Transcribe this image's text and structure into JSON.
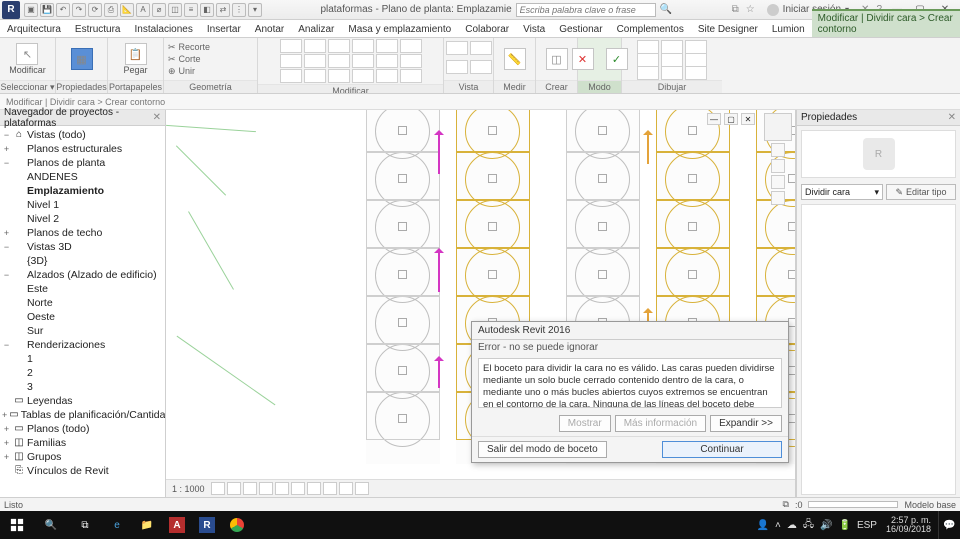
{
  "titlebar": {
    "doc_title": "plataformas - Plano de planta: Emplazamie",
    "search_placeholder": "Escriba palabra clave o frase",
    "login_label": "Iniciar sesión"
  },
  "tabs": {
    "items": [
      "Arquitectura",
      "Estructura",
      "Instalaciones",
      "Insertar",
      "Anotar",
      "Analizar",
      "Masa y emplazamiento",
      "Colaborar",
      "Vista",
      "Gestionar",
      "Complementos",
      "Site Designer",
      "Lumion"
    ],
    "context_label": "Modificar | Dividir cara > Crear contorno"
  },
  "ribbon": {
    "panels": {
      "seleccionar": "Seleccionar ▾",
      "modificar_btn": "Modificar",
      "propiedades": "Propiedades",
      "portapapeles": "Portapapeles",
      "pegar": "Pegar",
      "recorte": "Recorte",
      "corte": "Corte",
      "unir": "Unir",
      "geometria": "Geometría",
      "modificar": "Modificar",
      "vista": "Vista",
      "medir": "Medir",
      "crear": "Crear",
      "modo": "Modo",
      "dibujar": "Dibujar"
    }
  },
  "optbar": {
    "text": "Modificar | Dividir cara > Crear contorno"
  },
  "pb": {
    "title": "Navegador de proyectos - plataformas",
    "tree": [
      {
        "ind": 0,
        "tw": "−",
        "ic": "⌂",
        "label": "Vistas (todo)"
      },
      {
        "ind": 1,
        "tw": "+",
        "ic": "",
        "label": "Planos estructurales"
      },
      {
        "ind": 1,
        "tw": "−",
        "ic": "",
        "label": "Planos de planta"
      },
      {
        "ind": 2,
        "tw": "",
        "ic": "",
        "label": "ANDENES"
      },
      {
        "ind": 2,
        "tw": "",
        "ic": "",
        "label": "Emplazamiento",
        "bold": true
      },
      {
        "ind": 2,
        "tw": "",
        "ic": "",
        "label": "Nivel 1"
      },
      {
        "ind": 2,
        "tw": "",
        "ic": "",
        "label": "Nivel 2"
      },
      {
        "ind": 1,
        "tw": "+",
        "ic": "",
        "label": "Planos de techo"
      },
      {
        "ind": 1,
        "tw": "−",
        "ic": "",
        "label": "Vistas 3D"
      },
      {
        "ind": 2,
        "tw": "",
        "ic": "",
        "label": "{3D}"
      },
      {
        "ind": 1,
        "tw": "−",
        "ic": "",
        "label": "Alzados (Alzado de edificio)"
      },
      {
        "ind": 2,
        "tw": "",
        "ic": "",
        "label": "Este"
      },
      {
        "ind": 2,
        "tw": "",
        "ic": "",
        "label": "Norte"
      },
      {
        "ind": 2,
        "tw": "",
        "ic": "",
        "label": "Oeste"
      },
      {
        "ind": 2,
        "tw": "",
        "ic": "",
        "label": "Sur"
      },
      {
        "ind": 1,
        "tw": "−",
        "ic": "",
        "label": "Renderizaciones"
      },
      {
        "ind": 2,
        "tw": "",
        "ic": "",
        "label": "1"
      },
      {
        "ind": 2,
        "tw": "",
        "ic": "",
        "label": "2"
      },
      {
        "ind": 2,
        "tw": "",
        "ic": "",
        "label": "3"
      },
      {
        "ind": 0,
        "tw": "",
        "ic": "▭",
        "label": "Leyendas"
      },
      {
        "ind": 0,
        "tw": "+",
        "ic": "▭",
        "label": "Tablas de planificación/Cantidades"
      },
      {
        "ind": 0,
        "tw": "+",
        "ic": "▭",
        "label": "Planos (todo)"
      },
      {
        "ind": 0,
        "tw": "+",
        "ic": "◫",
        "label": "Familias"
      },
      {
        "ind": 0,
        "tw": "+",
        "ic": "◫",
        "label": "Grupos"
      },
      {
        "ind": 0,
        "tw": "",
        "ic": "⎘",
        "label": "Vínculos de Revit"
      }
    ]
  },
  "vcb": {
    "scale": "1 : 1000"
  },
  "props": {
    "title": "Propiedades",
    "selector": "Dividir cara",
    "edit_type": "Editar tipo"
  },
  "dialog": {
    "title": "Autodesk Revit 2016",
    "subtitle": "Error - no se puede ignorar",
    "message": "El boceto para dividir la cara no es válido. Las caras pueden dividirse mediante un solo bucle cerrado contenido dentro de la cara, o mediante uno o más bucles abiertos cuyos extremos se encuentran en el contorno de la cara. Ninguna de las líneas del boceto debe solapar ni intersecar los contornos de la cara.",
    "btn_show": "Mostrar",
    "btn_more": "Más información",
    "btn_expand": "Expandir >>",
    "btn_exit": "Salir del modo de boceto",
    "btn_continue": "Continuar"
  },
  "status": {
    "left": "Listo",
    "select_hint": ":0",
    "model_label": "Modelo base"
  },
  "taskbar": {
    "lang": "ESP",
    "time": "2:57 p. m.",
    "date": "16/09/2018"
  }
}
